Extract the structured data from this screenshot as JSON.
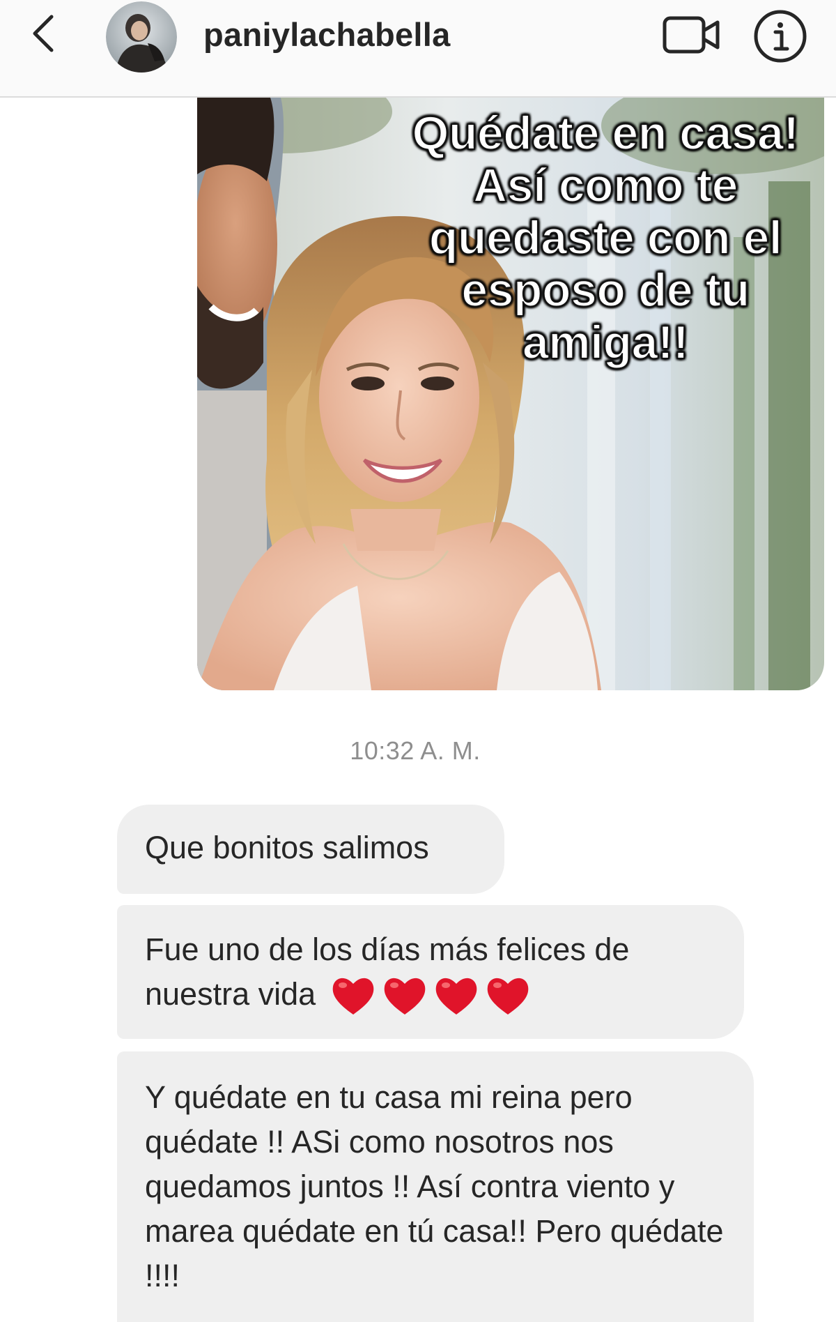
{
  "header": {
    "username": "paniylachabella"
  },
  "image_message": {
    "caption": "Quédate en casa!\nAsí como te\nquedaste con el\nesposo de tu\namiga!!"
  },
  "timestamp": "10:32 A. M.",
  "messages": [
    {
      "text": "Que bonitos salimos"
    },
    {
      "text": "Fue uno de los días más felices de nuestra vida",
      "emoji": [
        "heart",
        "heart",
        "heart",
        "heart"
      ]
    },
    {
      "text": "Y quédate en tu casa mi reina pero quédate !! ASi como nosotros nos quedamos juntos !! Así contra viento y marea quédate en tú casa!! Pero quédate !!!!"
    }
  ],
  "colors": {
    "bubble": "#efefef",
    "text": "#262626",
    "timestamp": "#8e8e8e",
    "heart": "#e0142a"
  }
}
